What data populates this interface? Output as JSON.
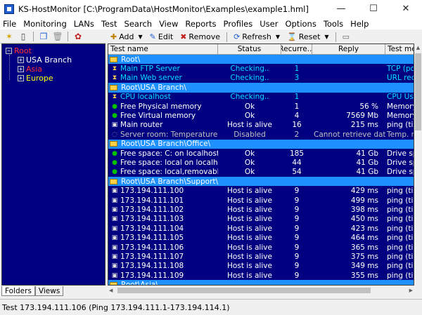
{
  "window": {
    "title": "KS-HostMonitor  [C:\\ProgramData\\HostMonitor\\Examples\\example1.hml]",
    "controls": {
      "minimize": "—",
      "maximize": "☐",
      "close": "✕"
    }
  },
  "menu": [
    "File",
    "Monitoring",
    "LANs",
    "Test",
    "Search",
    "View",
    "Reports",
    "Profiles",
    "User",
    "Options",
    "Tools",
    "Help"
  ],
  "toolbar": {
    "add": "Add",
    "edit": "Edit",
    "remove": "Remove",
    "refresh": "Refresh",
    "reset": "Reset"
  },
  "tree": {
    "root": "Root",
    "items": [
      {
        "label": "USA Branch",
        "color": "#ffffff"
      },
      {
        "label": "Asia",
        "color": "#ff3030"
      },
      {
        "label": "Europe",
        "color": "#ffff00"
      }
    ]
  },
  "left_tabs": {
    "folders": "Folders",
    "views": "Views"
  },
  "grid": {
    "columns": [
      "Test name",
      "Status",
      "Recurre...",
      "Reply",
      "Test me"
    ],
    "rows": [
      {
        "type": "folder",
        "name": "Root\\"
      },
      {
        "type": "test",
        "icon": "hourglass",
        "color": "#00e0ff",
        "name": "Main FTP Server",
        "status": "Checking..",
        "rec": "1",
        "reply": "",
        "method": "TCP (po"
      },
      {
        "type": "test",
        "icon": "hourglass",
        "color": "#00e0ff",
        "name": "Main Web server",
        "status": "Checking..",
        "rec": "3",
        "reply": "",
        "method": "URL rec"
      },
      {
        "type": "folder",
        "name": "Root\\USA Branch\\"
      },
      {
        "type": "test",
        "icon": "hourglass",
        "color": "#00e0ff",
        "name": "CPU localhost",
        "status": "Checking..",
        "rec": "1",
        "reply": "",
        "method": "CPU Us"
      },
      {
        "type": "test",
        "icon": "ok",
        "color": "#ffffff",
        "name": "Free Physical memory",
        "status": "Ok",
        "rec": "1",
        "reply": "56 %",
        "method": "Memory"
      },
      {
        "type": "test",
        "icon": "ok",
        "color": "#ffffff",
        "name": "Free Virtual memory",
        "status": "Ok",
        "rec": "4",
        "reply": "7569 Mb",
        "method": "Memory"
      },
      {
        "type": "test",
        "icon": "alive",
        "color": "#ffffff",
        "name": "Main router",
        "status": "Host is alive",
        "rec": "16",
        "reply": "215 ms",
        "method": "ping (tim"
      },
      {
        "type": "test",
        "icon": "disabled",
        "color": "#c0c0c0",
        "name": "Server room: Temperature",
        "status": "Disabled",
        "rec": "2",
        "reply": "Cannot retrieve data f...",
        "method": "Temp. m"
      },
      {
        "type": "folder",
        "name": "Root\\USA Branch\\Office\\"
      },
      {
        "type": "test",
        "icon": "ok",
        "color": "#ffffff",
        "name": "Free space: C: on localhost",
        "status": "Ok",
        "rec": "185",
        "reply": "41 Gb",
        "method": "Drive sp"
      },
      {
        "type": "test",
        "icon": "ok",
        "color": "#ffffff",
        "name": "Free space: local on localhost",
        "status": "Ok",
        "rec": "44",
        "reply": "41 Gb",
        "method": "Drive sp"
      },
      {
        "type": "test",
        "icon": "ok",
        "color": "#ffffff",
        "name": "Free space: local,removable on loc...",
        "status": "Ok",
        "rec": "54",
        "reply": "41 Gb",
        "method": "Drive sp"
      },
      {
        "type": "folder",
        "name": "Root\\USA Branch\\Support\\"
      },
      {
        "type": "test",
        "icon": "alive",
        "color": "#ffffff",
        "name": "173.194.111.100",
        "status": "Host is alive",
        "rec": "9",
        "reply": "429 ms",
        "method": "ping (tim"
      },
      {
        "type": "test",
        "icon": "alive",
        "color": "#ffffff",
        "name": "173.194.111.101",
        "status": "Host is alive",
        "rec": "9",
        "reply": "499 ms",
        "method": "ping (tim"
      },
      {
        "type": "test",
        "icon": "alive",
        "color": "#ffffff",
        "name": "173.194.111.102",
        "status": "Host is alive",
        "rec": "9",
        "reply": "398 ms",
        "method": "ping (tim"
      },
      {
        "type": "test",
        "icon": "alive",
        "color": "#ffffff",
        "name": "173.194.111.103",
        "status": "Host is alive",
        "rec": "9",
        "reply": "450 ms",
        "method": "ping (tim"
      },
      {
        "type": "test",
        "icon": "alive",
        "color": "#ffffff",
        "name": "173.194.111.104",
        "status": "Host is alive",
        "rec": "9",
        "reply": "423 ms",
        "method": "ping (tim"
      },
      {
        "type": "test",
        "icon": "alive",
        "color": "#ffffff",
        "name": "173.194.111.105",
        "status": "Host is alive",
        "rec": "9",
        "reply": "464 ms",
        "method": "ping (tim"
      },
      {
        "type": "test",
        "icon": "alive",
        "color": "#ffffff",
        "name": "173.194.111.106",
        "status": "Host is alive",
        "rec": "9",
        "reply": "365 ms",
        "method": "ping (tim"
      },
      {
        "type": "test",
        "icon": "alive",
        "color": "#ffffff",
        "name": "173.194.111.107",
        "status": "Host is alive",
        "rec": "9",
        "reply": "375 ms",
        "method": "ping (tim"
      },
      {
        "type": "test",
        "icon": "alive",
        "color": "#ffffff",
        "name": "173.194.111.108",
        "status": "Host is alive",
        "rec": "9",
        "reply": "349 ms",
        "method": "ping (tim"
      },
      {
        "type": "test",
        "icon": "alive",
        "color": "#ffffff",
        "name": "173.194.111.109",
        "status": "Host is alive",
        "rec": "9",
        "reply": "355 ms",
        "method": "ping (tim"
      },
      {
        "type": "folder",
        "name": "Root\\Asia\\"
      }
    ]
  },
  "statusbar": {
    "text": "Test 173.194.111.106 (Ping 173.194.111.1-173.194.114.1)"
  },
  "colors": {
    "panel_bg": "#000080",
    "folder_row": "#1e90ff",
    "checking_text": "#00e0ff",
    "ok_icon": "#00c000"
  }
}
